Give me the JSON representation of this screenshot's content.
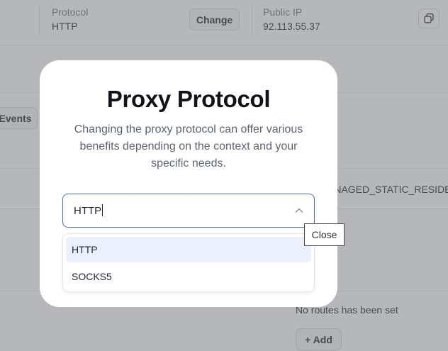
{
  "background": {
    "protocol_label": "Protocol",
    "protocol_value": "HTTP",
    "change_button": "Change",
    "public_ip_label": "Public IP",
    "public_ip_value": "92.113.55.37",
    "events_button": "Events",
    "type_value": "ANAGED_STATIC_RESIDE",
    "routes_empty": "No routes has been set",
    "add_button": "+ Add"
  },
  "modal": {
    "title": "Proxy Protocol",
    "description": "Changing the proxy protocol can offer various benefits depending on the context and your specific needs.",
    "select_value": "HTTP",
    "options": [
      "HTTP",
      "SOCKS5"
    ]
  },
  "tooltip": {
    "text": "Close"
  },
  "icons": {
    "copy": "copy-icon",
    "chevron": "chevron-up-icon"
  },
  "colors": {
    "accent": "#3f6ad8",
    "selected_option": "#eceffd"
  }
}
